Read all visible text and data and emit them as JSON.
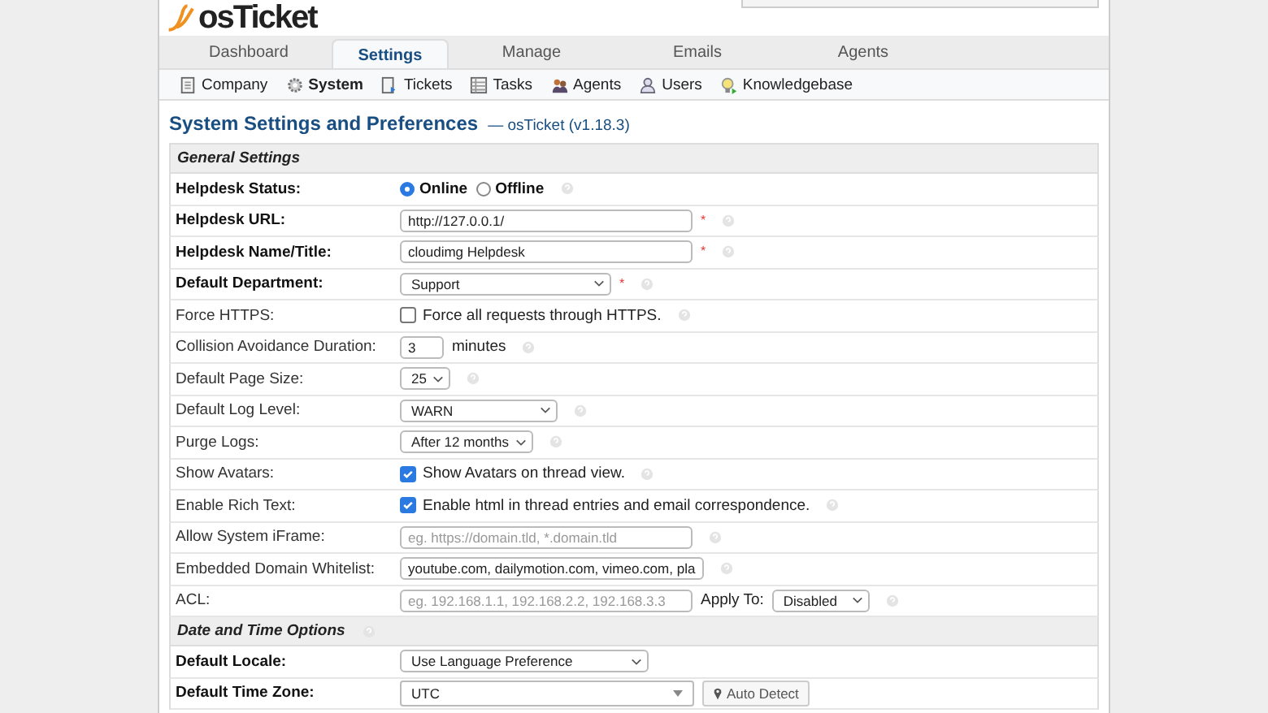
{
  "header": {
    "logo": "osTicket"
  },
  "nav_tabs": [
    {
      "label": "Dashboard",
      "selected": false
    },
    {
      "label": "Settings",
      "selected": true
    },
    {
      "label": "Manage",
      "selected": false
    },
    {
      "label": "Emails",
      "selected": false
    },
    {
      "label": "Agents",
      "selected": false
    }
  ],
  "sub_nav": [
    {
      "label": "Company",
      "selected": false
    },
    {
      "label": "System",
      "selected": true
    },
    {
      "label": "Tickets",
      "selected": false
    },
    {
      "label": "Tasks",
      "selected": false
    },
    {
      "label": "Agents",
      "selected": false
    },
    {
      "label": "Users",
      "selected": false
    },
    {
      "label": "Knowledgebase",
      "selected": false
    }
  ],
  "page_title": {
    "title": "System Settings and Preferences",
    "subtitle": "— osTicket (v1.18.3)"
  },
  "rows": [
    {
      "kind": "section",
      "label": "General Settings",
      "help": false
    },
    {
      "kind": "row",
      "label": "Helpdesk Status:",
      "bold": true,
      "help": true,
      "controls": [
        {
          "kind": "radio",
          "label": "Online",
          "selected": true
        },
        {
          "kind": "radio",
          "label": "Offline",
          "selected": false
        }
      ]
    },
    {
      "kind": "row",
      "label": "Helpdesk URL:",
      "bold": true,
      "help": true,
      "controls": [
        {
          "kind": "field",
          "value": "http://127.0.0.1/"
        },
        {
          "kind": "required",
          "text": "*"
        }
      ]
    },
    {
      "kind": "row",
      "label": "Helpdesk Name/Title:",
      "bold": true,
      "help": true,
      "controls": [
        {
          "kind": "field",
          "value": "cloudimg Helpdesk"
        },
        {
          "kind": "required",
          "text": "*"
        }
      ]
    },
    {
      "kind": "row",
      "label": "Default Department:",
      "bold": true,
      "help": true,
      "controls": [
        {
          "kind": "select",
          "value": "Support"
        },
        {
          "kind": "required",
          "text": "*"
        }
      ]
    },
    {
      "kind": "row",
      "label": "Force HTTPS:",
      "bold": false,
      "help": true,
      "controls": [
        {
          "kind": "checkbox",
          "checked": false,
          "label": "Force all requests through HTTPS."
        }
      ]
    },
    {
      "kind": "row",
      "label": "Collision Avoidance Duration:",
      "bold": false,
      "help": true,
      "controls": [
        {
          "kind": "number",
          "value": "3"
        },
        {
          "kind": "label",
          "text": "minutes"
        }
      ]
    },
    {
      "kind": "row",
      "label": "Default Page Size:",
      "bold": false,
      "help": true,
      "controls": [
        {
          "kind": "select",
          "value": "25"
        }
      ]
    },
    {
      "kind": "row",
      "label": "Default Log Level:",
      "bold": false,
      "help": true,
      "controls": [
        {
          "kind": "select",
          "value": "WARN"
        }
      ]
    },
    {
      "kind": "row",
      "label": "Purge Logs:",
      "bold": false,
      "help": true,
      "controls": [
        {
          "kind": "select",
          "value": "After 12 months"
        }
      ]
    },
    {
      "kind": "row",
      "label": "Show Avatars:",
      "bold": false,
      "help": true,
      "controls": [
        {
          "kind": "checkbox",
          "checked": true,
          "label": "Show Avatars on thread view."
        }
      ]
    },
    {
      "kind": "row",
      "label": "Enable Rich Text:",
      "bold": false,
      "help": true,
      "controls": [
        {
          "kind": "checkbox",
          "checked": true,
          "label": "Enable html in thread entries and email correspondence."
        }
      ]
    },
    {
      "kind": "row",
      "label": "Allow System iFrame:",
      "bold": false,
      "help": true,
      "controls": [
        {
          "kind": "field",
          "placeholder": "eg. https://domain.tld, *.domain.tld"
        }
      ]
    },
    {
      "kind": "row",
      "label": "Embedded Domain Whitelist:",
      "bold": false,
      "help": true,
      "controls": [
        {
          "kind": "field",
          "value": "youtube.com, dailymotion.com, vimeo.com, pla"
        }
      ]
    },
    {
      "kind": "row",
      "label": "ACL:",
      "bold": false,
      "help": true,
      "controls": [
        {
          "kind": "field",
          "placeholder": "eg. 192.168.1.1, 192.168.2.2, 192.168.3.3"
        },
        {
          "kind": "label",
          "text": "Apply To:"
        },
        {
          "kind": "select",
          "value": "Disabled"
        }
      ]
    },
    {
      "kind": "section",
      "label": "Date and Time Options",
      "help": true
    },
    {
      "kind": "row",
      "label": "Default Locale:",
      "bold": true,
      "help": false,
      "controls": [
        {
          "kind": "select",
          "value": "Use Language Preference"
        }
      ]
    },
    {
      "kind": "row",
      "label": "Default Time Zone:",
      "bold": true,
      "help": false,
      "controls": [
        {
          "kind": "combo",
          "value": "UTC"
        },
        {
          "kind": "button",
          "label": "Auto Detect"
        }
      ]
    }
  ]
}
